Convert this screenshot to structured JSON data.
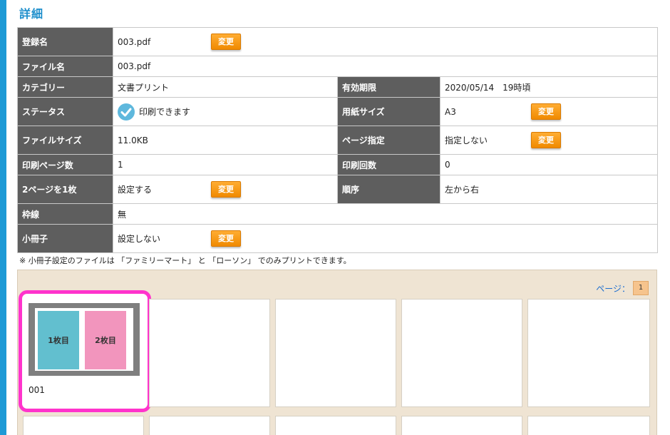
{
  "title": "詳細",
  "rows": {
    "registered_name": {
      "label": "登録名",
      "value": "003.pdf"
    },
    "file_name": {
      "label": "ファイル名",
      "value": "003.pdf"
    },
    "category": {
      "label": "カテゴリー",
      "value": "文書プリント"
    },
    "expiry": {
      "label": "有効期限",
      "value": "2020/05/14　19時頃"
    },
    "status": {
      "label": "ステータス",
      "value": "印刷できます"
    },
    "paper_size": {
      "label": "用紙サイズ",
      "value": "A3"
    },
    "file_size": {
      "label": "ファイルサイズ",
      "value": "11.0KB"
    },
    "page_spec": {
      "label": "ページ指定",
      "value": "指定しない"
    },
    "print_pages": {
      "label": "印刷ページ数",
      "value": "1"
    },
    "print_count": {
      "label": "印刷回数",
      "value": "0"
    },
    "two_in_one": {
      "label": "2ページを1枚",
      "value": "設定する"
    },
    "order": {
      "label": "順序",
      "value": "左から右"
    },
    "border": {
      "label": "枠線",
      "value": "無"
    },
    "booklet": {
      "label": "小冊子",
      "value": "設定しない"
    }
  },
  "change_button_label": "変更",
  "note": "※ 小冊子設定のファイルは 「ファミリーマート」 と 「ローソン」 でのみプリントできます。",
  "pager": {
    "label": "ページ：",
    "current": "1"
  },
  "thumbnail": {
    "label": "001",
    "page1": "1枚目",
    "page2": "2枚目"
  },
  "colors": {
    "accent_bar": "#1e9ad6",
    "title": "#1e8fcc",
    "label_bg": "#5e5e5e",
    "button": "#f59a12",
    "preview_bg": "#efe4d3",
    "selection": "#ff33cc",
    "page1": "#62bfcf",
    "page2": "#f295bd"
  }
}
